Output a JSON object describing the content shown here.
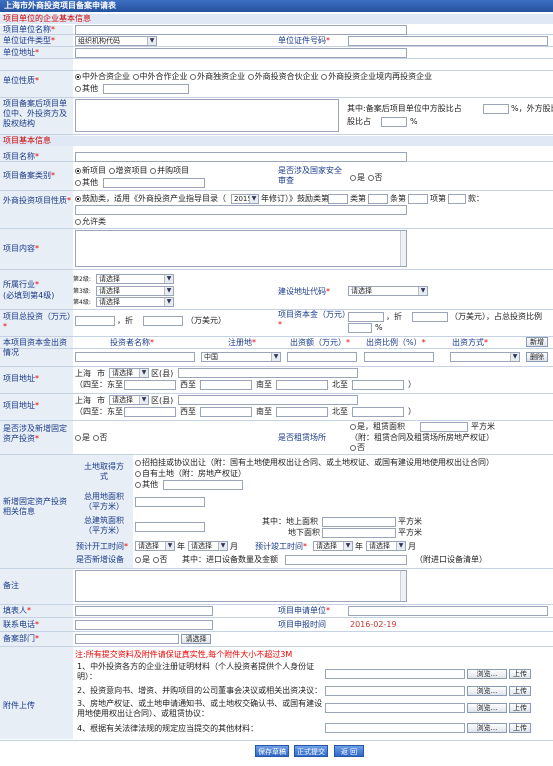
{
  "title": "上海市外商投资项目备案申请表",
  "sec1": "项目单位的企业基本信息",
  "project_unit_name": "项目单位名称",
  "cert_type": "单位证件类型",
  "cert_type_value": "组织机构代码",
  "cert_no": "单位证件号码",
  "unit_address": "单位地址",
  "unit_nature": "单位性质",
  "nature_opts": [
    "中外合资企业",
    "中外合作企业",
    "外商独资企业",
    "外商投资合伙企业",
    "外商投资企业境内再投资企业"
  ],
  "other": "其他",
  "equity_label": "项目备案后项目单位中、外投资方及股权结构",
  "equity_note": "其中:备案后项目单位中方股比占",
  "equity_pct": "%，外方股比占",
  "pct": "%",
  "sec2": "项目基本信息",
  "project_name": "项目名称",
  "filing_type": "项目备案类别",
  "filing_opts": [
    "新项目",
    "增资项目",
    "并购项目"
  ],
  "security_q": "是否涉及国家安全审查",
  "yes": "是",
  "no": "否",
  "industry_nature": "外商投资项目性质",
  "encourage": "鼓励类，适用《外商投资产业指导目录（",
  "year": "2015",
  "year_suffix": "年修订）》鼓励类第",
  "cls": "类第",
  "item": "条第",
  "xiang": "项第",
  "count": "款：",
  "allowed": "允许类",
  "content": "项目内容",
  "industry": "所属行业",
  "industry_sub": "(必填到第4级)",
  "level2": "第2级:",
  "level3": "第3级:",
  "level4": "第4级:",
  "select": "请选择",
  "region_code": "建设地址代码",
  "total_invest": "项目总投资（万元）",
  "zhe": "，折",
  "wanmei": "（万美元）",
  "capital": "项目资本金（万元）",
  "capital_tail": "（万美元），占总投资比例",
  "investor_label": "本项目资本金出资情况",
  "investor_cols": [
    "投资者名称",
    "注册地",
    "出资额（万元）",
    "出资比例（%）",
    "出资方式"
  ],
  "investor_country": "中国",
  "add": "新增",
  "del": "删除",
  "project_addr": "项目地址",
  "shanghai": "上海",
  "shi": "市",
  "qu": "区(县)",
  "siz": "（四至：东至",
  "west": "西至",
  "south": "南至",
  "north": "北至",
  "close": "）",
  "new_assets_q": "是否涉及新增固定资产投资",
  "rent_q": "是否租赁场所",
  "rent_yes": "是，租赁面积",
  "sqm": "平方米",
  "rent_attach": "（附：租赁合同及租赁场所房地产权证）",
  "new_assets": "新增固定资产投资相关信息",
  "land_method": "土地取得方式",
  "land_opts": [
    "招拍挂或协议出让（附：国有土地使用权出让合同、或土地权证、或国有建设用地使用权出让合同）",
    "自有土地（附：房地产权证）",
    "其他"
  ],
  "land_area": "总用地面积（平方米）",
  "build_area": "总建筑面积（平方米）",
  "above": "其中：地上面积",
  "below": "地下面积",
  "start_time": "预计开工时间",
  "end_time": "预计竣工时间",
  "nian": "年",
  "yue": "月",
  "new_equip": "是否新增设备",
  "equip_note": "其中：进口设备数量及金额",
  "equip_attach": "（附进口设备清单）",
  "remark": "备注",
  "filler": "填表人",
  "apply_unit": "项目申请单位",
  "phone": "联系电话",
  "apply_time": "项目申报时间",
  "apply_date": "2016-02-19",
  "dept": "备案部门",
  "choose": "请选择",
  "attach": "附件上传",
  "attach_note": "注:所有提交资料及附件请保证真实性,每个附件大小不超过3M",
  "attach_items": [
    "1、中外投资各方的企业注册证明材料（个人投资者提供个人身份证明）：",
    "2、投资意向书、增资、并购项目的公司董事会决议或相关出资决议：",
    "3、房地产权证、或土地申请通知书、或土地权交确认书、或国有建设用地使用权出让合同）、或租赁协议：",
    "4、根据有关法律法规的规定应当提交的其他材料："
  ],
  "browse": "浏览...",
  "upload": "上传",
  "save": "保存草稿",
  "submit": "正式提交",
  "back": "返 回"
}
